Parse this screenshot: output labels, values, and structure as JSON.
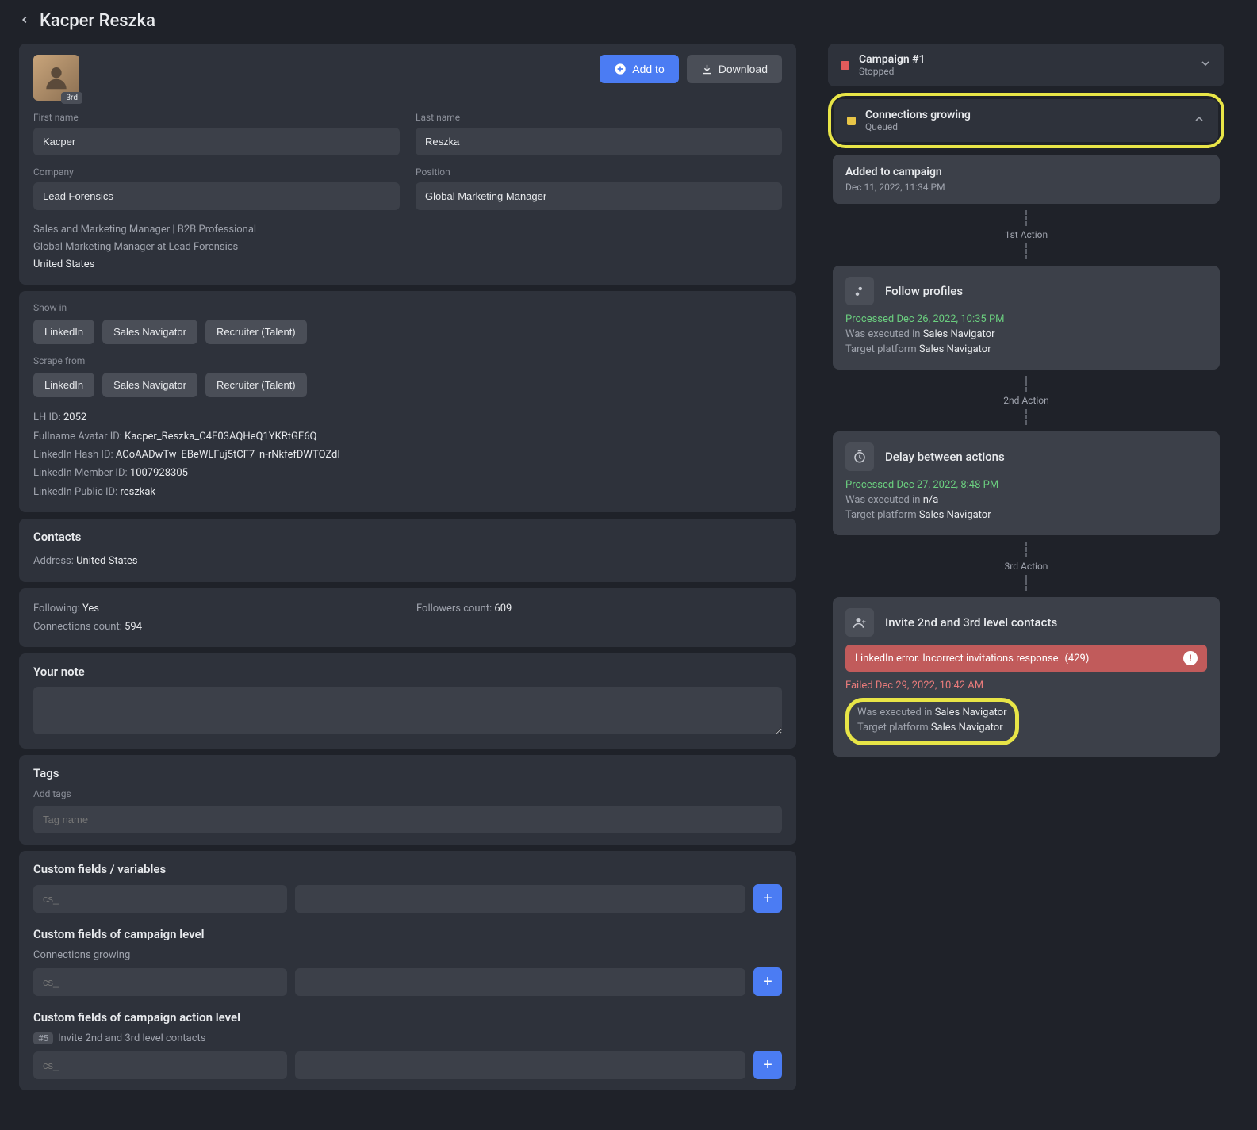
{
  "header": {
    "name": "Kacper Reszka"
  },
  "avatar": {
    "degree": "3rd"
  },
  "buttons": {
    "add_to": "Add to",
    "download": "Download"
  },
  "fields": {
    "first_name_label": "First name",
    "first_name": "Kacper",
    "last_name_label": "Last name",
    "last_name": "Reszka",
    "company_label": "Company",
    "company": "Lead Forensics",
    "position_label": "Position",
    "position": "Global Marketing Manager"
  },
  "meta": {
    "line1": "Sales and Marketing Manager | B2B Professional",
    "line2": "Global Marketing Manager at Lead Forensics",
    "line3": "United States"
  },
  "show_in": {
    "label": "Show in",
    "items": [
      "LinkedIn",
      "Sales Navigator",
      "Recruiter (Talent)"
    ]
  },
  "scrape_from": {
    "label": "Scrape from",
    "items": [
      "LinkedIn",
      "Sales Navigator",
      "Recruiter (Talent)"
    ]
  },
  "ids": {
    "lh_id_label": "LH ID:",
    "lh_id": "2052",
    "avatar_id_label": "Fullname Avatar ID:",
    "avatar_id": "Kacper_Reszka_C4E03AQHeQ1YKRtGE6Q",
    "hash_id_label": "LinkedIn Hash ID:",
    "hash_id": "ACoAADwTw_EBeWLFuj5tCF7_n-rNkfefDWTOZdI",
    "member_id_label": "LinkedIn Member ID:",
    "member_id": "1007928305",
    "public_id_label": "LinkedIn Public ID:",
    "public_id": "reszkak"
  },
  "contacts": {
    "title": "Contacts",
    "address_label": "Address:",
    "address": "United States",
    "following_label": "Following:",
    "following": "Yes",
    "followers_label": "Followers count:",
    "followers": "609",
    "connections_label": "Connections count:",
    "connections": "594"
  },
  "note": {
    "title": "Your note"
  },
  "tags": {
    "title": "Tags",
    "add_label": "Add tags",
    "placeholder": "Tag name"
  },
  "cf": {
    "title": "Custom fields / variables",
    "key_placeholder": "cs_",
    "camp_title": "Custom fields of campaign level",
    "camp_sub": "Connections growing",
    "action_title": "Custom fields of campaign action level",
    "action_badge": "#5",
    "action_sub": "Invite 2nd and 3rd level contacts"
  },
  "campaigns": [
    {
      "name": "Campaign #1",
      "status": "Stopped",
      "dot": "red"
    },
    {
      "name": "Connections growing",
      "status": "Queued",
      "dot": "yellow"
    }
  ],
  "timeline": {
    "added": {
      "title": "Added to campaign",
      "ts": "Dec 11, 2022, 11:34 PM"
    },
    "a1_label": "1st Action",
    "a1": {
      "title": "Follow profiles",
      "proc_label": "Processed",
      "proc_ts": "Dec 26, 2022, 10:35 PM",
      "exec_label": "Was executed in",
      "exec_val": "Sales Navigator",
      "target_label": "Target platform",
      "target_val": "Sales Navigator"
    },
    "a2_label": "2nd Action",
    "a2": {
      "title": "Delay between actions",
      "proc_label": "Processed",
      "proc_ts": "Dec 27, 2022, 8:48 PM",
      "exec_label": "Was executed in",
      "exec_val": "n/a",
      "target_label": "Target platform",
      "target_val": "Sales Navigator"
    },
    "a3_label": "3rd Action",
    "a3": {
      "title": "Invite 2nd and 3rd level contacts",
      "err_msg": "LinkedIn error. Incorrect invitations response",
      "err_code": "(429)",
      "fail_label": "Failed",
      "fail_ts": "Dec 29, 2022, 10:42 AM",
      "exec_label": "Was executed in",
      "exec_val": "Sales Navigator",
      "target_label": "Target platform",
      "target_val": "Sales Navigator"
    }
  }
}
